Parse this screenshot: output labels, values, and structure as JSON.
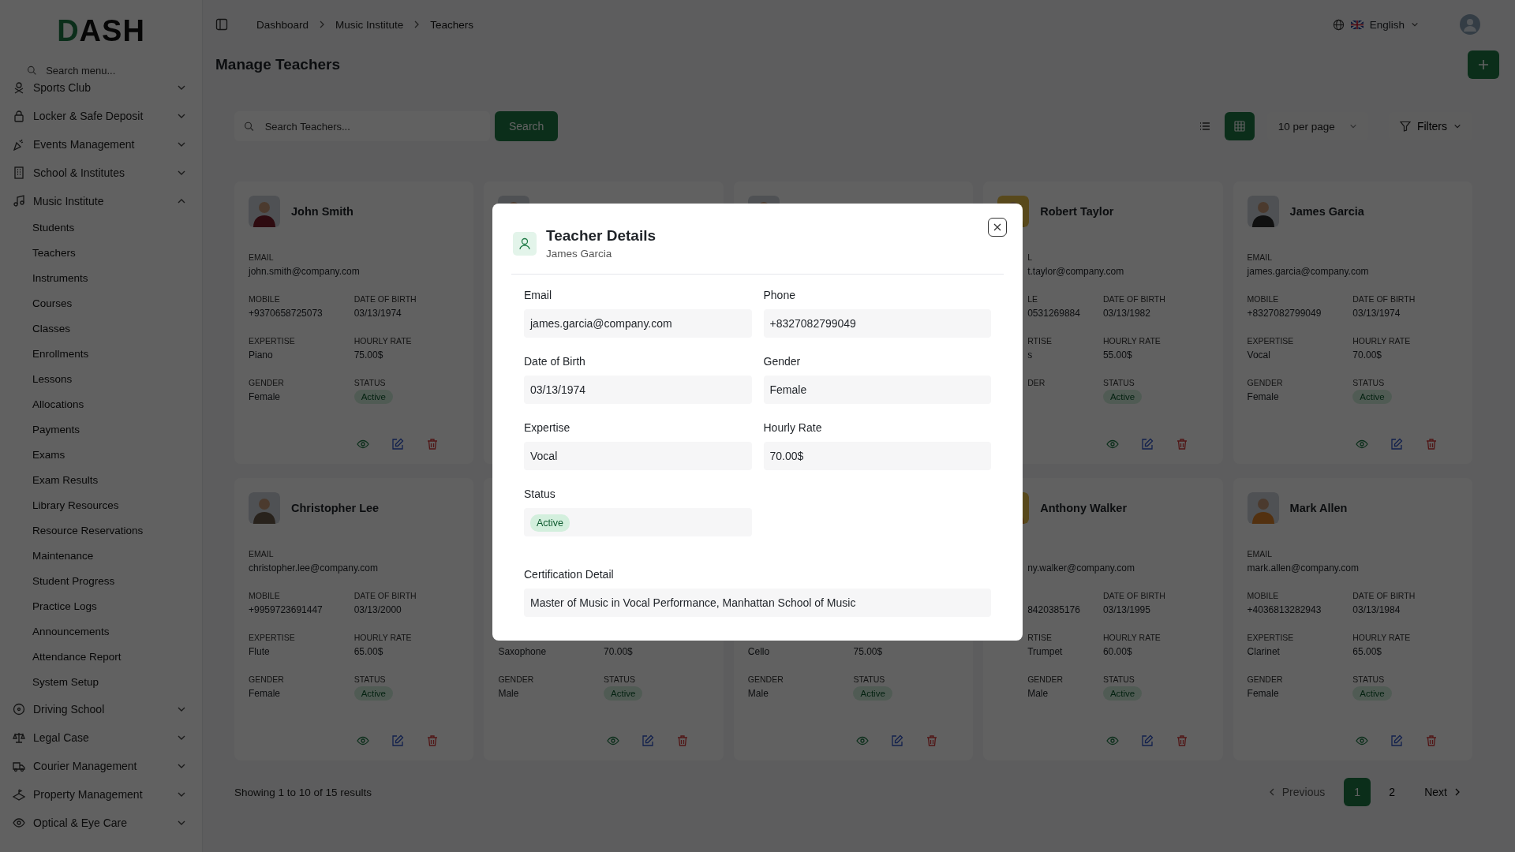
{
  "sidebar": {
    "logo": "DASH",
    "search": {
      "placeholder": "Search menu..."
    },
    "items": [
      {
        "label": "Sports Club",
        "kind": "sports",
        "expanded": false
      },
      {
        "label": "Locker & Safe Deposit",
        "kind": "lock",
        "expanded": false
      },
      {
        "label": "Events Management",
        "kind": "party",
        "expanded": false
      },
      {
        "label": "School & Institutes",
        "kind": "building",
        "expanded": false
      },
      {
        "label": "Music Institute",
        "kind": "music",
        "expanded": true,
        "children": [
          {
            "label": "Students"
          },
          {
            "label": "Teachers"
          },
          {
            "label": "Instruments"
          },
          {
            "label": "Courses"
          },
          {
            "label": "Classes"
          },
          {
            "label": "Enrollments"
          },
          {
            "label": "Lessons"
          },
          {
            "label": "Allocations"
          },
          {
            "label": "Payments"
          },
          {
            "label": "Exams"
          },
          {
            "label": "Exam Results"
          },
          {
            "label": "Library Resources"
          },
          {
            "label": "Resource Reservations"
          },
          {
            "label": "Maintenance"
          },
          {
            "label": "Student Progress"
          },
          {
            "label": "Practice Logs"
          },
          {
            "label": "Announcements"
          },
          {
            "label": "Attendance Report"
          },
          {
            "label": "System Setup"
          }
        ]
      },
      {
        "label": "Driving School",
        "kind": "wheel",
        "expanded": false
      },
      {
        "label": "Legal Case",
        "kind": "scale",
        "expanded": false
      },
      {
        "label": "Courier Management",
        "kind": "truck",
        "expanded": false
      },
      {
        "label": "Property Management",
        "kind": "land",
        "expanded": false
      },
      {
        "label": "Optical & Eye Care",
        "kind": "eye",
        "expanded": false
      }
    ]
  },
  "header": {
    "breadcrumbs": [
      "Dashboard",
      "Music Institute",
      "Teachers"
    ],
    "language": "English"
  },
  "page": {
    "title": "Manage Teachers"
  },
  "toolbar": {
    "search": {
      "placeholder": "Search Teachers..."
    },
    "search_button": "Search",
    "views": [
      {
        "kind": "list",
        "selected": false
      },
      {
        "kind": "grid",
        "selected": true
      }
    ],
    "per_page": "10 per page",
    "filters": "Filters"
  },
  "cards": [
    {
      "name": "John Smith",
      "photo": {
        "kind": "picture"
      },
      "email": {
        "label": "EMAIL",
        "value": "john.smith@company.com"
      },
      "mobile": {
        "label": "MOBILE",
        "value": "+9370658725073"
      },
      "dob": {
        "label": "DATE OF BIRTH",
        "value": "03/13/1974"
      },
      "expertise": {
        "label": "EXPERTISE",
        "value": "Piano"
      },
      "rate": {
        "label": "HOURLY RATE",
        "value": "75.00$"
      },
      "gender": {
        "label": "GENDER",
        "value": "Female"
      },
      "status": {
        "label": "STATUS",
        "value": "Active"
      },
      "actions": true
    },
    {
      "photo": {
        "kind": "picture"
      }
    },
    {
      "photo": {
        "kind": "picture"
      }
    },
    {
      "name": "Robert Taylor",
      "photo": {
        "kind": "picture"
      },
      "cut_left": true,
      "email": {
        "label": "L",
        "value": "t.taylor@company.com"
      },
      "mobile": {
        "label": "LE",
        "value": "0531269884"
      },
      "dob": {
        "label": "DATE OF BIRTH",
        "value": "03/13/1982"
      },
      "expertise": {
        "label": "RTISE",
        "value": "s"
      },
      "rate": {
        "label": "HOURLY RATE",
        "value": "55.00$"
      },
      "gender": {
        "label": "DER"
      },
      "status": {
        "label": "STATUS",
        "value": "Active"
      },
      "actions": true
    },
    {
      "name": "James Garcia",
      "photo": {
        "kind": "picture"
      },
      "email": {
        "label": "EMAIL",
        "value": "james.garcia@company.com"
      },
      "mobile": {
        "label": "MOBILE",
        "value": "+8327082799049"
      },
      "dob": {
        "label": "DATE OF BIRTH",
        "value": "03/13/1974"
      },
      "expertise": {
        "label": "EXPERTISE",
        "value": "Vocal"
      },
      "rate": {
        "label": "HOURLY RATE",
        "value": "70.00$"
      },
      "gender": {
        "label": "GENDER",
        "value": "Female"
      },
      "status": {
        "label": "STATUS",
        "value": "Active"
      },
      "actions": true
    },
    {
      "name": "Christopher Lee",
      "photo": {
        "kind": "picture"
      },
      "email": {
        "label": "EMAIL",
        "value": "christopher.lee@company.com"
      },
      "mobile": {
        "label": "MOBILE",
        "value": "+9959723691447"
      },
      "dob": {
        "label": "DATE OF BIRTH",
        "value": "03/13/2000"
      },
      "expertise": {
        "label": "EXPERTISE",
        "value": "Flute"
      },
      "rate": {
        "label": "HOURLY RATE",
        "value": "65.00$"
      },
      "gender": {
        "label": "GENDER",
        "value": "Female"
      },
      "status": {
        "label": "STATUS",
        "value": "Active"
      },
      "actions": true
    },
    {
      "expertise": {
        "value": "Saxophone"
      },
      "rate": {
        "value": "70.00$"
      },
      "gender": {
        "label": "GENDER",
        "value": "Male"
      },
      "status": {
        "label": "STATUS",
        "value": "Active"
      },
      "actions": true
    },
    {
      "expertise": {
        "value": "Cello"
      },
      "rate": {
        "value": "75.00$"
      },
      "gender": {
        "label": "GENDER",
        "value": "Male"
      },
      "status": {
        "label": "STATUS",
        "value": "Active"
      },
      "actions": true
    },
    {
      "name": "Anthony Walker",
      "photo": {
        "kind": "picture"
      },
      "cut_left": true,
      "email": {
        "value": "ny.walker@company.com"
      },
      "mobile": {
        "value": "8420385176"
      },
      "dob": {
        "label": "DATE OF BIRTH",
        "value": "03/13/1995"
      },
      "expertise": {
        "label": "RTISE",
        "value": "Trumpet"
      },
      "rate": {
        "label": "HOURLY RATE",
        "value": "60.00$"
      },
      "gender": {
        "label": "GENDER",
        "value": "Male"
      },
      "status": {
        "label": "STATUS",
        "value": "Active"
      },
      "actions": true
    },
    {
      "name": "Mark Allen",
      "photo": {
        "kind": "picture"
      },
      "email": {
        "label": "EMAIL",
        "value": "mark.allen@company.com"
      },
      "mobile": {
        "label": "MOBILE",
        "value": "+4036813282943"
      },
      "dob": {
        "label": "DATE OF BIRTH",
        "value": "03/13/1984"
      },
      "expertise": {
        "label": "EXPERTISE",
        "value": "Clarinet"
      },
      "rate": {
        "label": "HOURLY RATE",
        "value": "65.00$"
      },
      "gender": {
        "label": "GENDER",
        "value": "Female"
      },
      "status": {
        "label": "STATUS",
        "value": "Active"
      },
      "actions": true
    }
  ],
  "pagination": {
    "summary": "Showing 1 to 10 of 15 results",
    "previous": {
      "label": "Previous",
      "disabled": true
    },
    "pages": [
      {
        "label": "1",
        "selected": true
      },
      {
        "label": "2",
        "selected": false
      }
    ],
    "next": {
      "label": "Next",
      "disabled": false
    }
  },
  "modal": {
    "title": "Teacher Details",
    "subtitle": "James Garcia",
    "fields": [
      {
        "label": "Email",
        "value": "james.garcia@company.com",
        "kind": "text"
      },
      {
        "label": "Phone",
        "value": "+8327082799049",
        "kind": "text"
      },
      {
        "label": "Date of Birth",
        "value": "03/13/1974",
        "kind": "text"
      },
      {
        "label": "Gender",
        "value": "Female",
        "kind": "text"
      },
      {
        "label": "Expertise",
        "value": "Vocal",
        "kind": "text"
      },
      {
        "label": "Hourly Rate",
        "value": "70.00$",
        "kind": "text"
      },
      {
        "label": "Status",
        "value": "Active",
        "kind": "badge"
      },
      {
        "label": "Certification Detail",
        "value": "Master of Music in Vocal Performance, Manhattan School of Music",
        "kind": "wide"
      }
    ]
  }
}
